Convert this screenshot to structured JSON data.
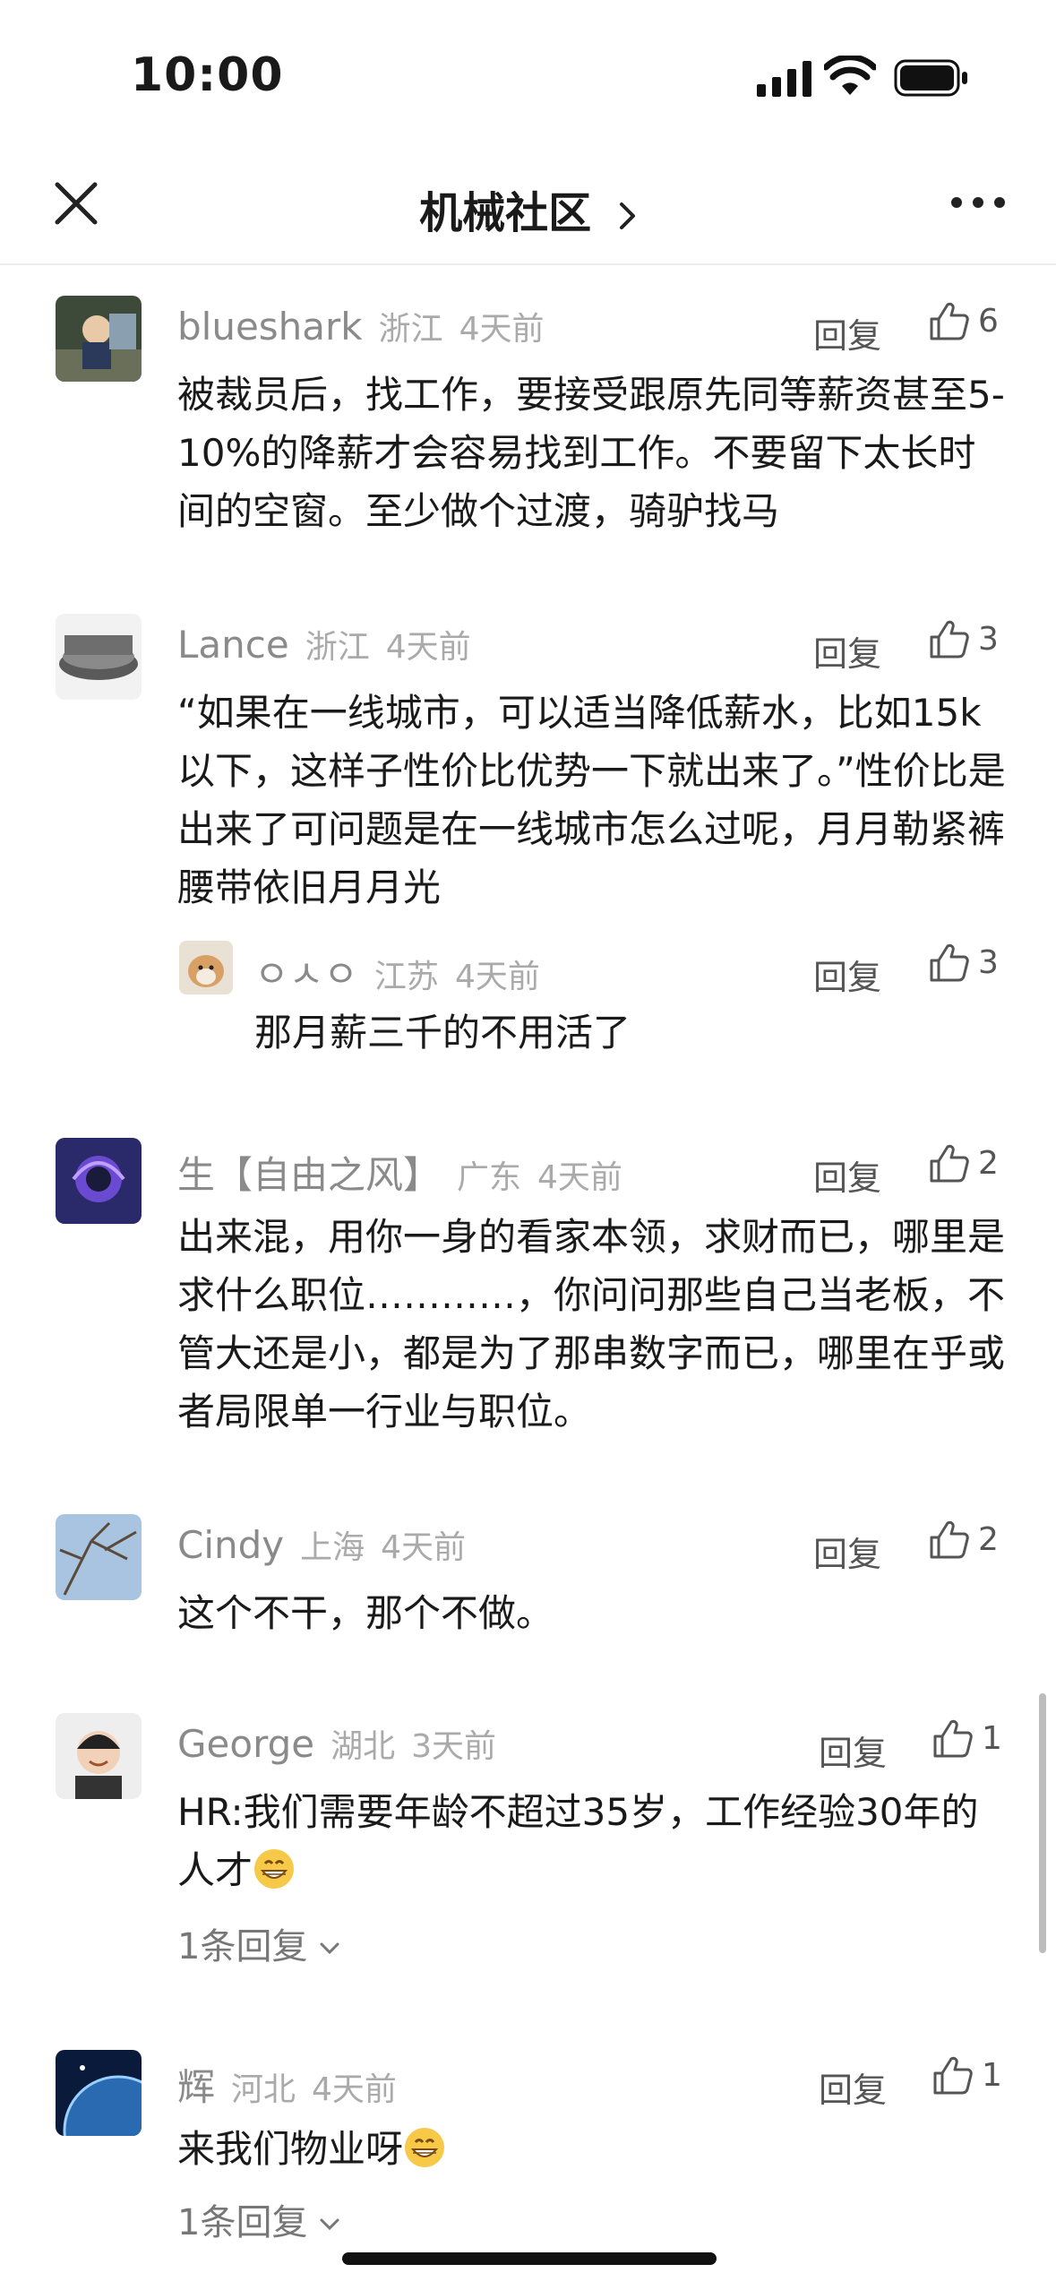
{
  "status": {
    "time": "10:00"
  },
  "nav": {
    "title": "机械社区"
  },
  "comments": [
    {
      "name": "blueshark",
      "location": "浙江",
      "ago": "4天前",
      "reply": "回复",
      "likes": "6",
      "text": "被裁员后，找工作，要接受跟原先同等薪资甚至5-10%的降薪才会容易找到工作。不要留下太长时间的空窗。至少做个过渡，骑驴找马"
    },
    {
      "name": "Lance",
      "location": "浙江",
      "ago": "4天前",
      "reply": "回复",
      "likes": "3",
      "text": "“如果在一线城市，可以适当降低薪水，比如15k以下，这样子性价比优势一下就出来了。”性价比是出来了可问题是在一线城市怎么过呢，月月勒紧裤腰带依旧月月光"
    },
    {
      "name": "ㅇㅅㅇ",
      "location": "江苏",
      "ago": "4天前",
      "reply": "回复",
      "likes": "3",
      "text": "那月薪三千的不用活了"
    },
    {
      "name": "生【自由之风】",
      "location": "广东",
      "ago": "4天前",
      "reply": "回复",
      "likes": "2",
      "text": "出来混，用你一身的看家本领，求财而已，哪里是求什么职位…………，你问问那些自己当老板，不管大还是小，都是为了那串数字而已，哪里在乎或者局限单一行业与职位。"
    },
    {
      "name": "Cindy",
      "location": "上海",
      "ago": "4天前",
      "reply": "回复",
      "likes": "2",
      "text": "这个不干，那个不做。"
    },
    {
      "name": "George",
      "location": "湖北",
      "ago": "3天前",
      "reply": "回复",
      "likes": "1",
      "text": "HR:我们需要年龄不超过35岁，工作经验30年的人才",
      "more": "1条回复"
    },
    {
      "name": "辉",
      "location": "河北",
      "ago": "4天前",
      "reply": "回复",
      "likes": "1",
      "text": "来我们物业呀",
      "more": "1条回复"
    }
  ]
}
